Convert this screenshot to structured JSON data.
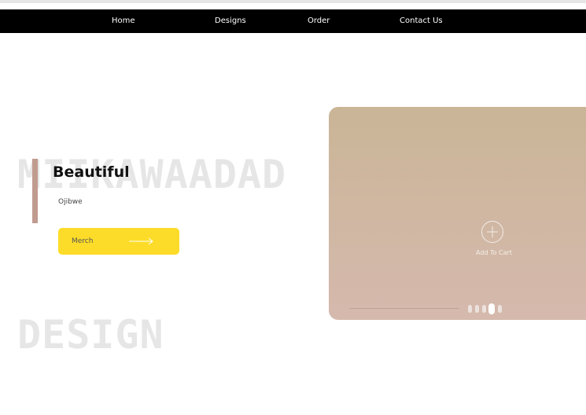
{
  "nav": {
    "items": [
      {
        "label": "Home"
      },
      {
        "label": "Designs"
      },
      {
        "label": "Order"
      },
      {
        "label": "Contact Us"
      }
    ]
  },
  "hero": {
    "background_title_line1": "MIIKAWAADAD",
    "background_title_line2": "DESIGN",
    "headline": "Beautiful",
    "subtitle": "Ojibwe",
    "cta_label": "Merch",
    "cta_icon": "arrow-right-icon"
  },
  "card": {
    "add_to_cart_label": "Add To Cart",
    "add_icon": "plus-circle-icon",
    "slides_count": 5,
    "active_slide_index": 3
  },
  "colors": {
    "nav_bg": "#000000",
    "accent_bar": "#c09b8f",
    "cta_bg": "#fcdc28",
    "card_gradient_top": "#cab597",
    "card_gradient_bottom": "#d5b9ad",
    "background_title": "#e6e6e6"
  }
}
